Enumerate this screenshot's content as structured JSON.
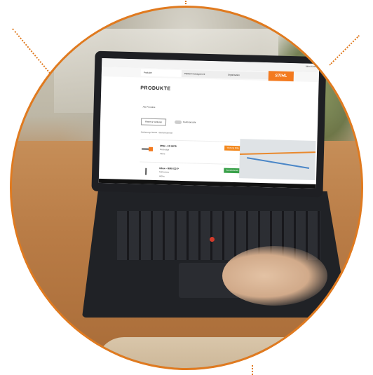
{
  "scene": {
    "type": "photo",
    "description_hidden": true
  },
  "screen": {
    "tabs": [
      "Produkte",
      "Plattformmanagement",
      "Organisation"
    ],
    "brand": "STIHL",
    "user": "Mein Konto",
    "page_title": "PRODUKTE",
    "filter_tab": "Alle Produkte",
    "filter_button": "Filtern & Sortieren",
    "toggle_label": "Kartenansicht",
    "sort_label": "Sortierung: Name / Seriennummer",
    "rows": [
      {
        "name": "MSB - 2O 8678",
        "sub": "Motorsäge",
        "status": "Aktive",
        "button": "Wartung fällig"
      },
      {
        "name": "iMow - RMI 632 P",
        "sub": "Mähroboter",
        "status": "Aktive",
        "button": "Betriebsbereit"
      }
    ]
  },
  "colors": {
    "accent": "#e07a1f",
    "brand": "#f37a1f",
    "ok": "#3aa14a"
  }
}
